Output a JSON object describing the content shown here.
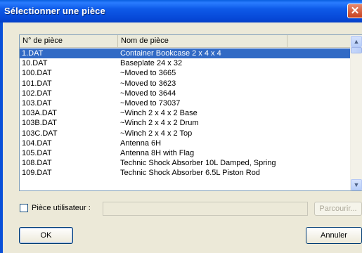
{
  "window": {
    "title": "Sélectionner une pièce",
    "close_glyph": "✕"
  },
  "list": {
    "columns": [
      "N° de pièce",
      "Nom de pièce",
      ""
    ],
    "selected_index": 0,
    "rows": [
      {
        "id": "1.DAT",
        "name": "Container Bookcase  2 x  4 x  4"
      },
      {
        "id": "10.DAT",
        "name": "Baseplate 24 x 32"
      },
      {
        "id": "100.DAT",
        "name": "~Moved to 3665"
      },
      {
        "id": "101.DAT",
        "name": "~Moved to 3623"
      },
      {
        "id": "102.DAT",
        "name": "~Moved to 3644"
      },
      {
        "id": "103.DAT",
        "name": "~Moved to 73037"
      },
      {
        "id": "103A.DAT",
        "name": "~Winch  2 x  4 x  2 Base"
      },
      {
        "id": "103B.DAT",
        "name": "~Winch  2 x  4 x  2 Drum"
      },
      {
        "id": "103C.DAT",
        "name": "~Winch  2 x  4 x  2 Top"
      },
      {
        "id": "104.DAT",
        "name": "Antenna  6H"
      },
      {
        "id": "105.DAT",
        "name": "Antenna  8H with Flag"
      },
      {
        "id": "108.DAT",
        "name": "Technic Shock Absorber 10L Damped, Spring"
      },
      {
        "id": "109.DAT",
        "name": "Technic Shock Absorber  6.5L Piston Rod"
      }
    ]
  },
  "user_part": {
    "label": "Pièce utilisateur :",
    "checked": false,
    "value": "",
    "browse_label": "Parcourir..."
  },
  "buttons": {
    "ok": "OK",
    "cancel": "Annuler"
  },
  "icons": {
    "close": "close-icon",
    "scroll_up": "chevron-up-icon",
    "scroll_down": "chevron-down-icon"
  },
  "colors": {
    "titlebar": "#0a5fe0",
    "selection": "#316ac5",
    "dialog_bg": "#ece9d8"
  }
}
